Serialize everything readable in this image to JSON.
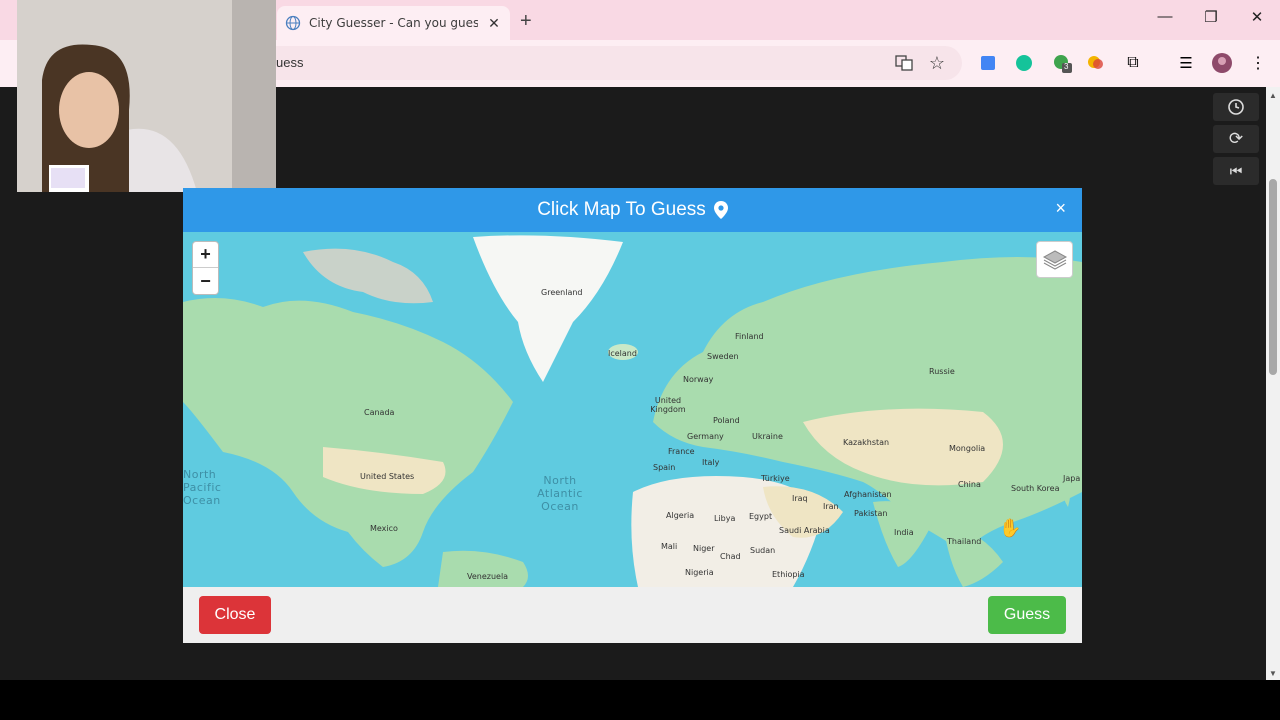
{
  "browser": {
    "tab_title": "City Guesser - Can you guess w",
    "url_fragment": "uess",
    "extension_badge": "3"
  },
  "modal": {
    "title": "Click Map To Guess",
    "close_x": "×",
    "close_label": "Close",
    "guess_label": "Guess"
  },
  "map": {
    "zoom_in": "+",
    "zoom_out": "−",
    "oceans": [
      {
        "text": "North\nPacific\nOcean"
      },
      {
        "text": "North\nAtlantic\nOcean"
      }
    ],
    "labels": [
      "Greenland",
      "Iceland",
      "Finland",
      "Sweden",
      "Norway",
      "Russie",
      "United Kingdom",
      "Poland",
      "Germany",
      "Ukraine",
      "France",
      "Spain",
      "Italy",
      "Kazakhstan",
      "Mongolia",
      "China",
      "South Korea",
      "Japa",
      "Türkiye",
      "Iraq",
      "Iran",
      "Afghanistan",
      "Pakistan",
      "India",
      "Thailand",
      "Canada",
      "United States",
      "Mexico",
      "Venezuela",
      "Algeria",
      "Libya",
      "Egypt",
      "Saudi Arabia",
      "Mali",
      "Niger",
      "Chad",
      "Sudan",
      "Nigeria",
      "Ethiopia"
    ]
  }
}
